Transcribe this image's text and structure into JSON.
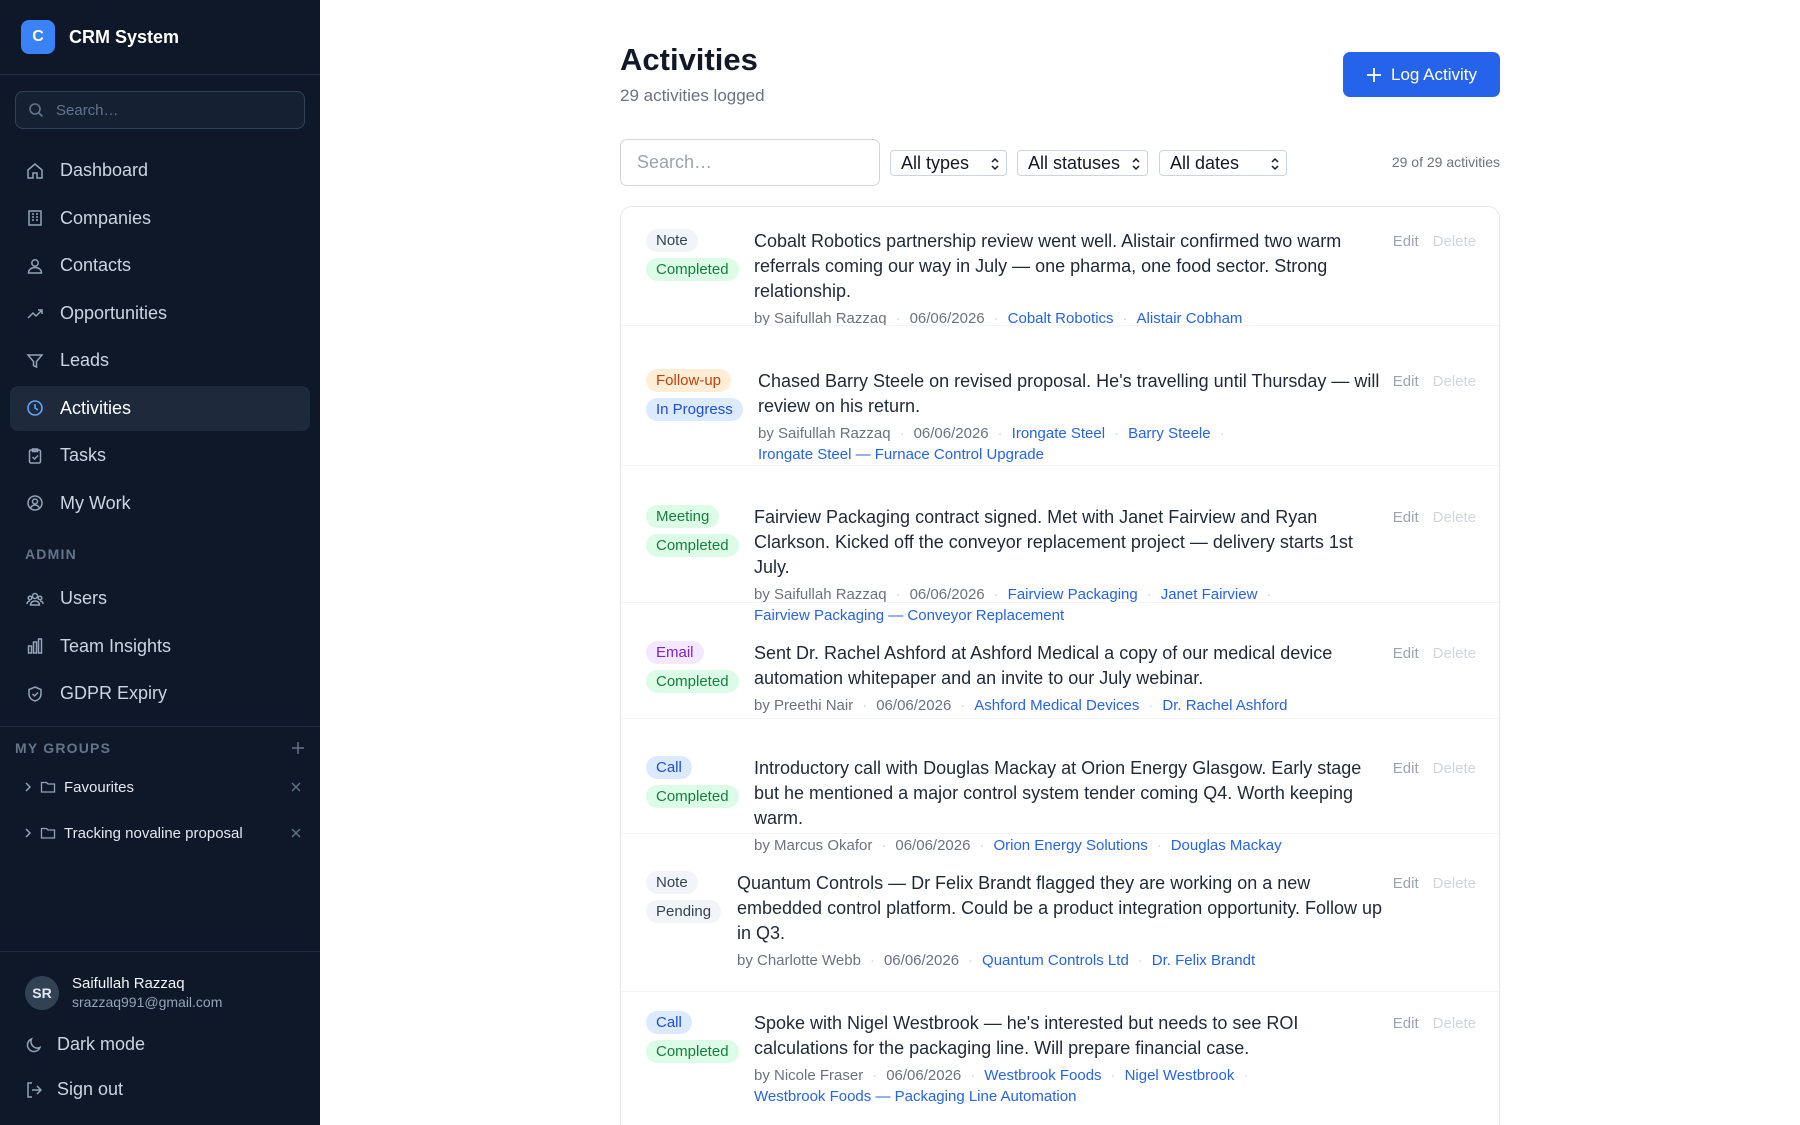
{
  "app": {
    "logo_letter": "C",
    "name": "CRM System"
  },
  "sidebar": {
    "search_placeholder": "Search…",
    "nav": [
      {
        "label": "Dashboard",
        "icon": "home-icon"
      },
      {
        "label": "Companies",
        "icon": "building-icon"
      },
      {
        "label": "Contacts",
        "icon": "users-icon"
      },
      {
        "label": "Opportunities",
        "icon": "trending-up-icon"
      },
      {
        "label": "Leads",
        "icon": "filter-icon"
      },
      {
        "label": "Activities",
        "icon": "clock-icon",
        "active": true
      },
      {
        "label": "Tasks",
        "icon": "clipboard-icon"
      },
      {
        "label": "My Work",
        "icon": "user-circle-icon"
      }
    ],
    "admin_label": "ADMIN",
    "admin_nav": [
      {
        "label": "Users",
        "icon": "user-group-icon"
      },
      {
        "label": "Team Insights",
        "icon": "bar-chart-icon"
      },
      {
        "label": "GDPR Expiry",
        "icon": "shield-icon"
      }
    ],
    "groups_label": "MY GROUPS",
    "groups": [
      {
        "label": "Favourites"
      },
      {
        "label": "Tracking novaline proposal"
      }
    ],
    "user": {
      "initials": "SR",
      "name": "Saifullah Razzaq",
      "email": "srazzaq991@gmail.com"
    },
    "dark_mode_label": "Dark mode",
    "sign_out_label": "Sign out"
  },
  "header": {
    "title": "Activities",
    "subtitle": "29 activities logged",
    "log_button": "Log Activity"
  },
  "filters": {
    "search_placeholder": "Search…",
    "type_select": "All types",
    "status_select": "All statuses",
    "date_select": "All dates",
    "count_text": "29 of 29 activities"
  },
  "actions": {
    "edit": "Edit",
    "delete": "Delete"
  },
  "activities": [
    {
      "type": "Note",
      "status": "Completed",
      "text": "Cobalt Robotics partnership review went well. Alistair confirmed two warm referrals coming our way in July — one pharma, one food sector. Strong relationship.",
      "by": "by Saifullah Razzaq",
      "date": "06/06/2026",
      "company": "Cobalt Robotics",
      "contact": "Alistair Cobham",
      "opportunity": ""
    },
    {
      "type": "Follow-up",
      "status": "In Progress",
      "text": "Chased Barry Steele on revised proposal. He's travelling until Thursday — will review on his return.",
      "by": "by Saifullah Razzaq",
      "date": "06/06/2026",
      "company": "Irongate Steel",
      "contact": "Barry Steele",
      "opportunity": "Irongate Steel — Furnace Control Upgrade"
    },
    {
      "type": "Meeting",
      "status": "Completed",
      "text": "Fairview Packaging contract signed. Met with Janet Fairview and Ryan Clarkson. Kicked off the conveyor replacement project — delivery starts 1st July.",
      "by": "by Saifullah Razzaq",
      "date": "06/06/2026",
      "company": "Fairview Packaging",
      "contact": "Janet Fairview",
      "opportunity": "Fairview Packaging — Conveyor Replacement"
    },
    {
      "type": "Email",
      "status": "Completed",
      "text": "Sent Dr. Rachel Ashford at Ashford Medical a copy of our medical device automation whitepaper and an invite to our July webinar.",
      "by": "by Preethi Nair",
      "date": "06/06/2026",
      "company": "Ashford Medical Devices",
      "contact": "Dr. Rachel Ashford",
      "opportunity": ""
    },
    {
      "type": "Call",
      "status": "Completed",
      "text": "Introductory call with Douglas Mackay at Orion Energy Glasgow. Early stage but he mentioned a major control system tender coming Q4. Worth keeping warm.",
      "by": "by Marcus Okafor",
      "date": "06/06/2026",
      "company": "Orion Energy Solutions",
      "contact": "Douglas Mackay",
      "opportunity": ""
    },
    {
      "type": "Note",
      "status": "Pending",
      "text": "Quantum Controls — Dr Felix Brandt flagged they are working on a new embedded control platform. Could be a product integration opportunity. Follow up in Q3.",
      "by": "by Charlotte Webb",
      "date": "06/06/2026",
      "company": "Quantum Controls Ltd",
      "contact": "Dr. Felix Brandt",
      "opportunity": ""
    },
    {
      "type": "Call",
      "status": "Completed",
      "text": "Spoke with Nigel Westbrook — he's interested but needs to see ROI calculations for the packaging line. Will prepare financial case.",
      "by": "by Nicole Fraser",
      "date": "06/06/2026",
      "company": "Westbrook Foods",
      "contact": "Nigel Westbrook",
      "opportunity": "Westbrook Foods — Packaging Line Automation"
    }
  ],
  "colors": {
    "sidebar_bg": "#0f1829",
    "accent": "#2563eb",
    "link": "#2563eb",
    "badge_note_bg": "#f1f5f9",
    "badge_followup_bg": "#ffedd5",
    "badge_meeting_bg": "#dcfce7",
    "badge_email_bg": "#f3e8ff",
    "badge_call_bg": "#dbeafe",
    "badge_completed_bg": "#dcfce7",
    "badge_inprogress_bg": "#dbeafe",
    "badge_pending_bg": "#f1f5f9"
  }
}
